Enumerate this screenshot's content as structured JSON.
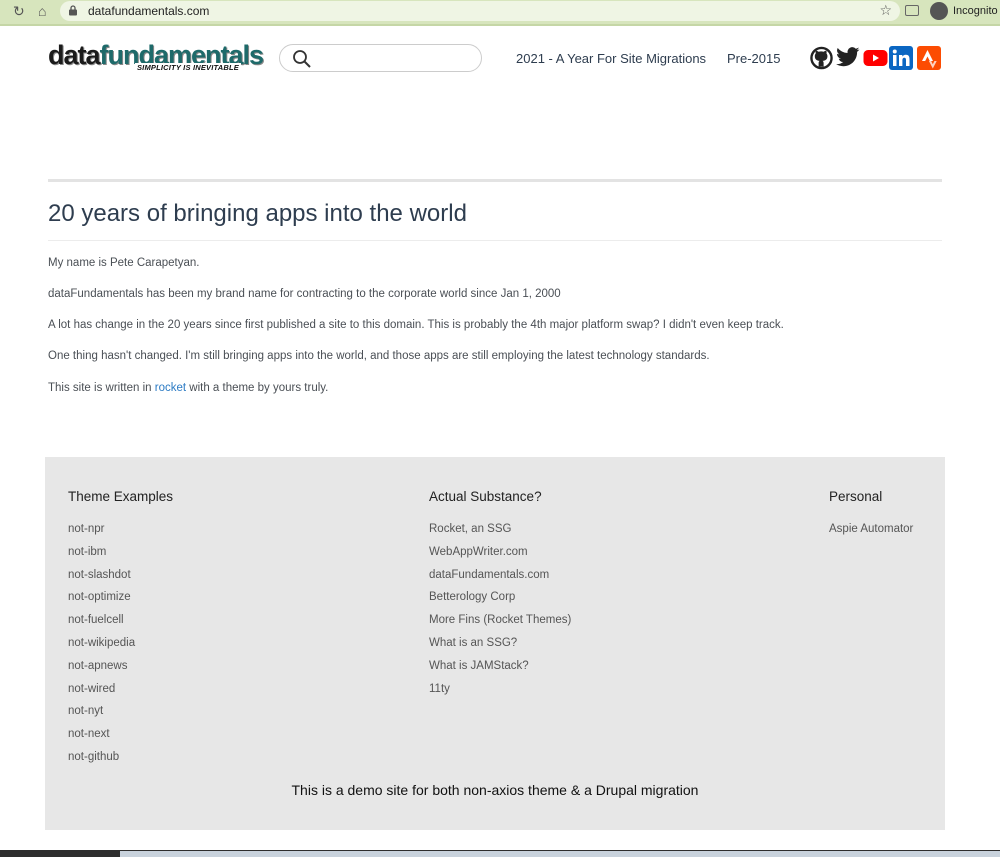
{
  "browser": {
    "url": "datafundamentals.com",
    "profile_label": "Incognito",
    "icons": [
      "reload-icon",
      "home-icon",
      "lock-icon",
      "star-icon",
      "cast-icon",
      "incognito-icon"
    ]
  },
  "header": {
    "logo_text": "datafundamentals",
    "logo_tagline": "SIMPLICITY IS INEVITABLE",
    "search": {
      "value": "",
      "placeholder": ""
    },
    "nav": [
      {
        "label": "2021 - A Year For Site Migrations"
      },
      {
        "label": "Pre-2015"
      }
    ],
    "social_icons": [
      "github-icon",
      "twitter-icon",
      "youtube-icon",
      "linkedin-icon",
      "strava-icon"
    ]
  },
  "article": {
    "title": "20 years of bringing apps into the world",
    "paragraphs": [
      "My name is Pete Carapetyan.",
      "dataFundamentals has been my brand name for contracting to the corporate world since Jan 1, 2000",
      "A lot has change in the 20 years since first published a site to this domain. This is probably the 4th major platform swap? I didn't even keep track.",
      "One thing hasn't changed. I'm still bringing apps into the world, and those apps are still employing the latest technology standards."
    ],
    "last_paragraph": {
      "before": "This site is written in ",
      "link": "rocket",
      "after": " with a theme by yours truly."
    }
  },
  "footer": {
    "columns": [
      {
        "title": "Theme Examples",
        "links": [
          "not-npr",
          "not-ibm",
          "not-slashdot",
          "not-optimize",
          "not-fuelcell",
          "not-wikipedia",
          "not-apnews",
          "not-wired",
          "not-nyt",
          "not-next",
          "not-github"
        ]
      },
      {
        "title": "Actual Substance?",
        "links": [
          "Rocket, an SSG",
          "WebAppWriter.com",
          "dataFundamentals.com",
          "Betterology Corp",
          "More Fins (Rocket Themes)",
          "What is an SSG?",
          "What is JAMStack?",
          "11ty"
        ]
      },
      {
        "title": "Personal",
        "links": [
          "Aspie Automator"
        ]
      }
    ],
    "note": "This is a demo site for both non-axios theme & a Drupal migration"
  },
  "colors": {
    "chrome_bar": "#d7e5bd",
    "heading": "#2e3d4f",
    "link": "#2c7bc4",
    "footer_bg": "#e7e7e7",
    "youtube": "#ff0000",
    "linkedin": "#0a66c2",
    "strava": "#fc4c02",
    "twitter": "#1d9bf0"
  }
}
